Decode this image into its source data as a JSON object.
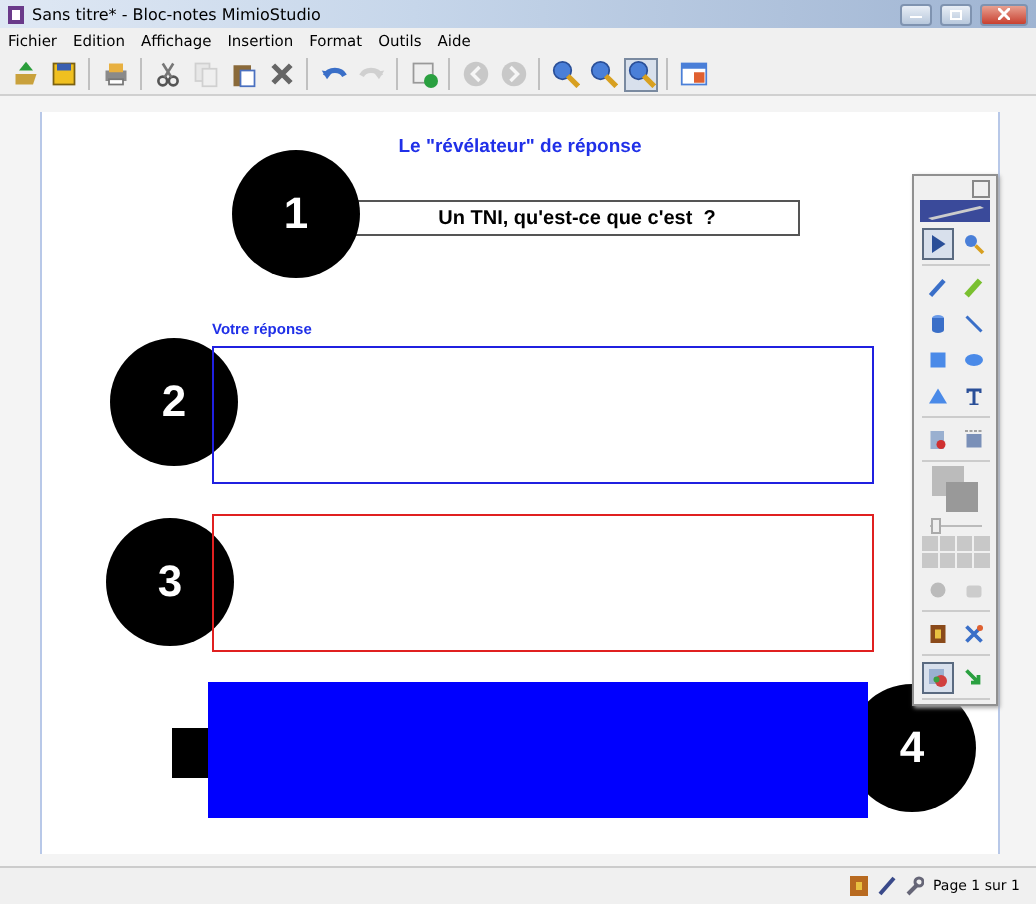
{
  "window": {
    "title": "Sans titre* - Bloc-notes MimioStudio"
  },
  "menu": [
    "Fichier",
    "Edition",
    "Affichage",
    "Insertion",
    "Format",
    "Outils",
    "Aide"
  ],
  "toolbar": [
    {
      "disabled": false,
      "pressed": false
    },
    {
      "disabled": false,
      "pressed": false
    },
    {
      "disabled": false,
      "pressed": false
    },
    {
      "disabled": false,
      "pressed": false
    },
    {
      "disabled": true,
      "pressed": false
    },
    {
      "disabled": false,
      "pressed": false
    },
    {
      "disabled": false,
      "pressed": false
    },
    {
      "disabled": false,
      "pressed": false
    },
    {
      "disabled": true,
      "pressed": false
    },
    {
      "disabled": false,
      "pressed": false
    },
    {
      "disabled": true,
      "pressed": false
    },
    {
      "disabled": true,
      "pressed": false
    },
    {
      "disabled": false,
      "pressed": false
    },
    {
      "disabled": false,
      "pressed": false
    },
    {
      "disabled": false,
      "pressed": true
    },
    {
      "disabled": false,
      "pressed": false
    }
  ],
  "page": {
    "heading": "Le \"révélateur\" de réponse",
    "question": "Un TNI, qu'est-ce que c'est  ?",
    "answer_label": "Votre réponse",
    "markers": [
      "1",
      "2",
      "3",
      "4"
    ]
  },
  "palette": [
    {
      "selected": true
    },
    {
      "selected": false
    },
    {
      "selected": false
    },
    {
      "selected": false
    },
    {
      "selected": false
    },
    {
      "selected": false
    },
    {
      "selected": false
    },
    {
      "selected": false
    },
    {
      "selected": false
    },
    {
      "selected": false
    },
    {
      "selected": false
    },
    {
      "selected": false
    },
    {
      "selected": false
    },
    {
      "selected": false
    },
    {
      "selected": false
    },
    {
      "selected": false
    },
    {
      "selected": true
    },
    {
      "selected": false
    }
  ],
  "status_bar": {
    "page": "Page 1 sur 1"
  }
}
